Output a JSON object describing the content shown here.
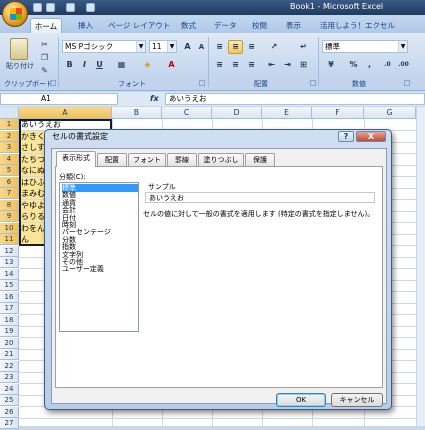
{
  "window": {
    "title": "Book1 - Microsoft Excel"
  },
  "ribbon_tabs": [
    "ホーム",
    "挿入",
    "ページ レイアウト",
    "数式",
    "データ",
    "校閲",
    "表示",
    "活用しよう！エクセル"
  ],
  "ribbon": {
    "clipboard": {
      "paste_label": "貼り付け",
      "group_label": "クリップボード"
    },
    "font": {
      "name": "MS Pゴシック",
      "size": "11",
      "group_label": "フォント"
    },
    "alignment": {
      "group_label": "配置"
    },
    "number": {
      "format": "標準",
      "group_label": "数値"
    }
  },
  "formula_bar": {
    "name_box": "A1",
    "fx": "fx",
    "content": "あいうえお"
  },
  "columns": [
    "A",
    "B",
    "C",
    "D",
    "E",
    "F",
    "G"
  ],
  "rows": [
    "1",
    "2",
    "3",
    "4",
    "5",
    "6",
    "7",
    "8",
    "9",
    "10",
    "11",
    "12",
    "13",
    "14",
    "15",
    "16",
    "17",
    "18",
    "19",
    "20",
    "21",
    "22",
    "23",
    "24",
    "25",
    "26",
    "27"
  ],
  "cells_a": [
    "あいうえお",
    "かきくけこ",
    "さしすせそ",
    "たちつてと",
    "なにぬねの",
    "はひふへほ",
    "まみむめも",
    "やゆよ",
    "らりるれろ",
    "わをん",
    "ん"
  ],
  "dialog": {
    "title": "セルの書式設定",
    "help": "?",
    "close": "X",
    "tabs": [
      "表示形式",
      "配置",
      "フォント",
      "罫線",
      "塗りつぶし",
      "保護"
    ],
    "category_label": "分類(C):",
    "categories": [
      "標準",
      "数値",
      "通貨",
      "会計",
      "日付",
      "時刻",
      "パーセンテージ",
      "分数",
      "指数",
      "文字列",
      "その他",
      "ユーザー定義"
    ],
    "selected_category": "標準",
    "sample_label": "サンプル",
    "sample_value": "あいうえお",
    "description": "セルの値に対して一般の書式を適用します (特定の書式を指定しません)。",
    "ok": "OK",
    "cancel": "キャンセル"
  }
}
